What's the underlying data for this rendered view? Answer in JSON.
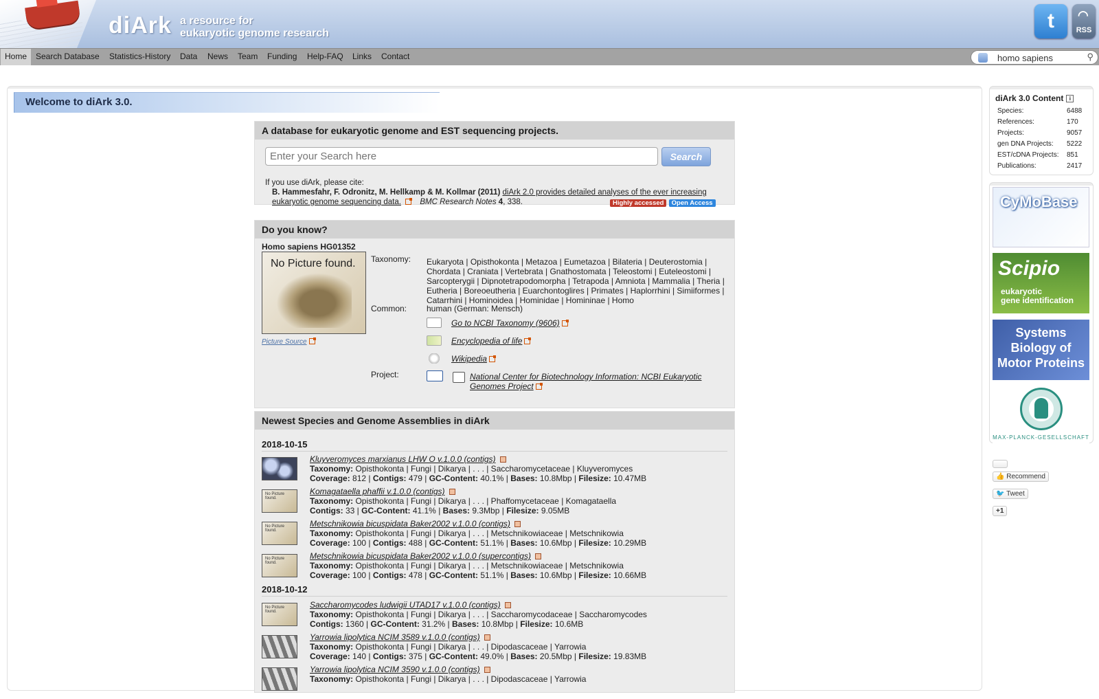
{
  "header": {
    "brand": "diArk",
    "tagline_line1": "a resource for",
    "tagline_line2": "eukaryotic genome research",
    "twitter_label": "t",
    "rss_label": "RSS"
  },
  "nav": {
    "items": [
      "Home",
      "Search Database",
      "Statistics-History",
      "Data",
      "News",
      "Team",
      "Funding",
      "Help-FAQ",
      "Links",
      "Contact"
    ],
    "active": "Home",
    "search_value": "homo sapiens"
  },
  "welcome": "Welcome to diArk 3.0.",
  "intro": {
    "title": "A database for eukaryotic genome and EST sequencing projects.",
    "search_placeholder": "Enter your Search here",
    "search_button": "Search",
    "cite_intro": "If you use diArk, please cite:",
    "authors": "B. Hammesfahr, F. Odronitz, M. Hellkamp & M. Kollmar (2011)",
    "paper_title_1": "diArk 2.0 provides detailed analyses of the ever increasing",
    "paper_title_2": "eukaryotic genome sequencing data.",
    "journal": "BMC Research Notes",
    "volume": "4",
    "pages": ", 338.",
    "badge_highly": "Highly accessed",
    "badge_open": "Open Access"
  },
  "dyk": {
    "title": "Do you know?",
    "species": "Homo sapiens HG01352",
    "no_picture": "No Picture found.",
    "picture_source": "Picture Source",
    "taxonomy_label": "Taxonomy:",
    "taxonomy_lines": [
      "Eukaryota | Opisthokonta | Metazoa | Eumetazoa | Bilateria | Deuterostomia |",
      "Chordata | Craniata | Vertebrata | Gnathostomata | Teleostomi | Euteleostomi |",
      "Sarcopterygii | Dipnotetrapodomorpha | Tetrapoda | Amniota | Mammalia | Theria |",
      "Eutheria | Boreoeutheria | Euarchontoglires | Primates | Haplorrhini | Simiiformes |",
      "Catarrhini | Hominoidea | Hominidae | Homininae | Homo"
    ],
    "common_label": "Common:",
    "common_value": "human (German: Mensch)",
    "links": [
      "Go to NCBI Taxonomy (9606)",
      "Encyclopedia of life",
      "Wikipedia"
    ],
    "project_label": "Project:",
    "project_line1": "National Center for Biotechnology Information: NCBI Eukaryotic",
    "project_line2": "Genomes Project"
  },
  "newest": {
    "title": "Newest Species and Genome Assemblies in diArk",
    "groups": [
      {
        "date": "2018-10-15",
        "items": [
          {
            "title": "Kluyveromyces marxianus LHW O v.1.0.0 (contigs)",
            "taxonomy": "Opisthokonta | Fungi | Dikarya | . . . | Saccharomycetaceae | Kluyveromyces",
            "line2": [
              [
                "Coverage:",
                "812 |"
              ],
              [
                "Contigs:",
                "479 |"
              ],
              [
                "GC-Content:",
                "40.1% |"
              ],
              [
                "Bases:",
                "10.8Mbp |"
              ],
              [
                "Filesize:",
                "10.47MB"
              ]
            ]
          },
          {
            "title": "Komagataella phaffii v.1.0.0 (contigs)",
            "taxonomy": "Opisthokonta | Fungi | Dikarya | . . . | Phaffomycetaceae | Komagataella",
            "line2": [
              [
                "Contigs:",
                "33 |"
              ],
              [
                "GC-Content:",
                "41.1% |"
              ],
              [
                "Bases:",
                "9.3Mbp |"
              ],
              [
                "Filesize:",
                "9.05MB"
              ]
            ]
          },
          {
            "title": "Metschnikowia bicuspidata Baker2002 v.1.0.0 (contigs)",
            "taxonomy": "Opisthokonta | Fungi | Dikarya | . . . | Metschnikowiaceae | Metschnikowia",
            "line2": [
              [
                "Coverage:",
                "100 |"
              ],
              [
                "Contigs:",
                "488 |"
              ],
              [
                "GC-Content:",
                "51.1% |"
              ],
              [
                "Bases:",
                "10.6Mbp |"
              ],
              [
                "Filesize:",
                "10.29MB"
              ]
            ]
          },
          {
            "title": "Metschnikowia bicuspidata Baker2002 v.1.0.0 (supercontigs)",
            "taxonomy": "Opisthokonta | Fungi | Dikarya | . . . | Metschnikowiaceae | Metschnikowia",
            "line2": [
              [
                "Coverage:",
                "100 |"
              ],
              [
                "Contigs:",
                "478 |"
              ],
              [
                "GC-Content:",
                "51.1% |"
              ],
              [
                "Bases:",
                "10.6Mbp |"
              ],
              [
                "Filesize:",
                "10.66MB"
              ]
            ]
          }
        ]
      },
      {
        "date": "2018-10-12",
        "items": [
          {
            "title": "Saccharomycodes ludwigii UTAD17 v.1.0.0 (contigs)",
            "taxonomy": "Opisthokonta | Fungi | Dikarya | . . . | Saccharomycodaceae | Saccharomycodes",
            "line2": [
              [
                "Contigs:",
                "1360 |"
              ],
              [
                "GC-Content:",
                "31.2% |"
              ],
              [
                "Bases:",
                "10.8Mbp |"
              ],
              [
                "Filesize:",
                "10.6MB"
              ]
            ]
          },
          {
            "title": "Yarrowia lipolytica NCIM 3589 v.1.0.0 (contigs)",
            "taxonomy": "Opisthokonta | Fungi | Dikarya | . . . | Dipodascaceae | Yarrowia",
            "line2": [
              [
                "Coverage:",
                "140 |"
              ],
              [
                "Contigs:",
                "375 |"
              ],
              [
                "GC-Content:",
                "49.0% |"
              ],
              [
                "Bases:",
                "20.5Mbp |"
              ],
              [
                "Filesize:",
                "19.83MB"
              ]
            ]
          },
          {
            "title": "Yarrowia lipolytica NCIM 3590 v.1.0.0 (contigs)",
            "taxonomy": "Opisthokonta | Fungi | Dikarya | . . . | Dipodascaceae | Yarrowia",
            "line2": []
          }
        ]
      }
    ]
  },
  "sidebar": {
    "stats_title": "diArk 3.0 Content",
    "stats": [
      {
        "label": "Species:",
        "value": "6488"
      },
      {
        "label": "References:",
        "value": "170"
      },
      {
        "label": "Projects:",
        "value": "9057"
      },
      {
        "label": "gen DNA Projects:",
        "value": "5222"
      },
      {
        "label": "EST/cDNA Projects:",
        "value": "851"
      },
      {
        "label": "Publications:",
        "value": "2417"
      }
    ],
    "banners": {
      "cymobase": "CyMoBase",
      "scipio": "Scipio",
      "scipio_sub1": "eukaryotic",
      "scipio_sub2": "gene identification",
      "sbmp1": "Systems",
      "sbmp2": "Biology of",
      "sbmp3": "Motor Proteins",
      "mpg": "MAX-PLANCK-GESELLSCHAFT"
    },
    "recommend": "Recommend",
    "tweet": "Tweet",
    "plusone": "+1"
  }
}
